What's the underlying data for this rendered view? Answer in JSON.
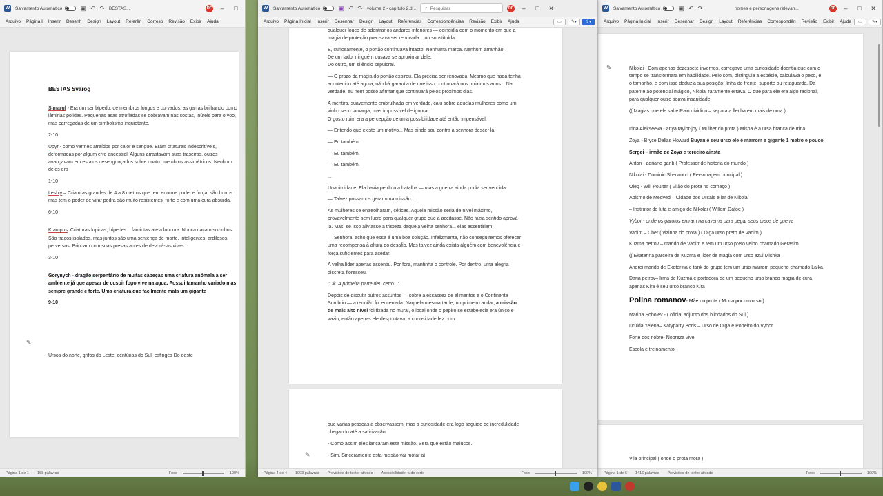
{
  "colors": {
    "word_blue": "#2b579a",
    "accent_red": "#d9352b",
    "toggle_blue": "#2f6ad9"
  },
  "left": {
    "autosave": "Salvamento Automático",
    "title": "BESTAS...",
    "avatar": "RF",
    "menu": [
      "Arquivo",
      "Página I",
      "Inserir",
      "Desenh",
      "Design",
      "Layout",
      "Referên",
      "Corresp",
      "Revisão",
      "Exibir",
      "Ajuda"
    ],
    "doc_title_pre": "BESTAS ",
    "doc_title_name": "Svarog",
    "p1_name": "Simargl",
    "p1": " - Era um ser bípedo, de membros longos e curvados, as garras brilhando como lâminas polidas. Pequenas asas atrofiadas se dobravam nas costas, inúteis para o voo, mas carregadas de um simbolismo inquietante.",
    "r1": "2-10",
    "p2_name": "Upyr",
    "p2": " - como vermes atraídos por calor e sangue. Eram criaturas indescritíveis, deformadas por algum erro ancestral. Alguns arrastavam suas traseiras, outros avançavam em estalos desengonçados sobre quatro membros assimétricos. Nenhum deles era",
    "r2": "1-10",
    "p3_name": "Leshiy",
    "p3": " – Criaturas grandes de 4 a 8 metros que tem enorme poder e força, são burros mas tem o poder de virar pedra são muito resistentes, forte e com uma cura absurda.",
    "r3": "6-10",
    "p4_name": "Krampus",
    "p4": ". Criaturas lupinas, bípedes... famintas até a loucura. Nunca caçam sozinhos. São fracos isolados, mas juntos são uma sentença de morte. Inteligentes, ardilosos, perversos. Brincam com suas presas antes de devorá-las vivas.",
    "r4": "3-10",
    "p5_name": "Gorynych - dragão",
    "p5": " serpentário de muitas cabeças uma criatura anômala a ser ambiente já que apesar de cuspir fogo vive na agua. Possui tamanho variado mas sempre grande e forte. Uma criatura que facilmente mata um gigante",
    "r5": "9-10",
    "footer_text": "Ursos do norte, grifos do Leste, centúrias do Sul, esfinges Do oeste",
    "status_page": "Página 1 de 1",
    "status_words": "168 palavras",
    "status_focus": "Foco",
    "zoom": "100%"
  },
  "center": {
    "autosave": "Salvamento Automático",
    "title": "volume 2 - capítulo 2.d...",
    "search": "Pesquisar",
    "avatar": "RF",
    "menu": [
      "Arquivo",
      "Página Inicial",
      "Inserir",
      "Desenhar",
      "Design",
      "Layout",
      "Referências",
      "Correspondências",
      "Revisão",
      "Exibir",
      "Ajuda"
    ],
    "paragraphs": [
      "qualquer louco de adentrar os andares inferiores — coincidia com o momento em que a magia de proteção precisava ser renovada... ou substituída.",
      "E, curiosamente, o portão continuava intacto. Nenhuma marca. Nenhum arranhão.",
      "De um lado, ninguém ousava se aproximar dele.",
      "Do outro, um silêncio sepulcral.",
      "— O prazo da magia do portão expirou. Ela precisa ser renovada. Mesmo que nada tenha acontecido até agora, não há garantia de que isso continuará nos próximos anos... Na verdade, eu nem posso afirmar que continuará pelos próximos dias.",
      "A mentira, suavemente embrulhada em verdade, caiu sobre aquelas mulheres como um vinho seco: amarga, mas impossível de ignorar.",
      "O gosto ruim era a percepção de uma possibilidade até então impensável.",
      "— Entendo que existe um motivo... Mas ainda sou contra a senhora descer lá.",
      "— Eu também.",
      "— Eu também.",
      "— Eu também.",
      "...",
      "Unanimidade. Ela havia perdido a batalha — mas a guerra ainda podia ser vencida.",
      "— Talvez possamos gerar uma missão...",
      "As mulheres se entreolharam, céticas. Aquela missão seria de nível máximo, provavelmente sem lucro para qualquer grupo que a aceitasse. Não fazia sentido aprová-la. Mas, se isso aliviasse a tristeza daquela velha senhora... elas assentiriam.",
      "— Senhora, acho que essa é uma boa solução. Infelizmente, não conseguiremos oferecer uma recompensa à altura do desafio. Mas talvez ainda exista alguém com benevolência e força suficientes para aceitar.",
      "A velha líder apenas assentiu. Por fora, mantinha o controle. Por dentro, uma alegria discreta floresceu."
    ],
    "quote": "\"Ok. A primeira parte deu certo...\"",
    "last_pre": "Depois de discutir outros assuntos — sobre a escassez de alimentos e o Continente Sombrio — a reunião foi encerrada. Naquela mesma tarde, no primeiro andar, ",
    "last_bold": "a missão de mais alto nível",
    "last_post": " foi fixada no mural, o local onde o papiro se estabelecia era único e vazio, então apenas ele despontava, a curiosidade fez com",
    "page2": [
      "que varias pessoas a observassem, mas a curiosidade era logo seguido de incredulidade chegando até a satirização.",
      "- Como assim eles lançaram esta missão. Sera que estão malucos.",
      "- Sim. Sinceramente esta missão vai mofar aí"
    ],
    "status_page": "Página 4 de 4",
    "status_words": "1003 palavras",
    "status_pred": "Previsões de texto: ativado",
    "status_access": "Acessibilidade: tudo certo",
    "status_focus": "Foco",
    "zoom": "100%"
  },
  "right": {
    "autosave": "Salvamento Automático",
    "title": "nomes e personagens relevan...",
    "avatar": "RF",
    "menu": [
      "Arquivo",
      "Página Inicial",
      "Inserir",
      "Desenhar",
      "Design",
      "Layout",
      "Referências",
      "Correspondên",
      "Revisão",
      "Exibir",
      "Ajuda"
    ],
    "intro": "Nikolai - Com apenas dezessete invernos, carregava uma curiosidade doentia que com o tempo se transformara em habilidade. Pelo som, distinguia a espécie, calculava o peso, e o tamanho, e com isso deduzia sua posição: linha de frente, suporte ou retaguarda. Da patente ao potencial mágico, Nikolai raramente errava. O que para ele era algo racional, para qualquer outro soava insanidade.",
    "magias": "(( Magias que ele sabe Raio dividido – separa a flecha em mais de uma )",
    "lines": [
      "Irina Alekseeva - anya taylor-joy  ( Mulher do prota )  Misha é a ursa branca de Irina",
      "Zoya -  Bryce Dallas Howard ",
      "Sergei – irmão de Zoya e terceiro ainsta",
      "Anton - adriano garib ( Professor de historia do mundo )",
      "Nikolai - Dominic Sherwood  ( Personagem principal )",
      "Oleg - Will Poulter ( Vilão do prota no começo )",
      "Abismo de Medved – Cidade dos Ursais e lar de Nikolai",
      "– Instrutor de luta e amigo de Nikolai ( Willem Dafoe )",
      "Vybor - onde os garotos entram na caverna para pegar seus ursos de guerra",
      "Vadim – Cher ( vizinha do prota ) ( Olga urso preto de Vadim )",
      "Kuzma petrov – marido de Vadim e tem um urso preto velho chamado Gerasim",
      "((  Ekaterina  parceira de Kuzma e líder de magia com urso azul  Mishka",
      "    Andrei   marido de Ekaterina e tank do grupo tem um urso marrom pequeno chamado Laika",
      " Daria petrov– Irma de Kuzma e portadora de um pequeno urso branco magia de cura apenas Kira é seu urso branco Kira"
    ],
    "zoya_bold": "Buyan é seu urso ele é marrom e gigante 1 metro e pouco",
    "polina": "Polina romanov",
    "polina_sub": "- Mãe do prota ( Morta por um urso )",
    "after": [
      "Marina Sobolev -        ( oficial adjunto dos blindados do Sul )",
      "Druida Yelena– Katyparry  Boris – Urso de Olga e Porteiro do Vybor",
      "Forte dos nobre- Nobreza vive",
      "Escola e treinamento"
    ],
    "page2": "Vila principal ( onde o prota mora )",
    "status_page": "Página 1 de 6",
    "status_words": "1416 palavras",
    "status_pred": "Previsões de texto: ativado",
    "status_focus": "Foco",
    "zoom": "100%"
  }
}
